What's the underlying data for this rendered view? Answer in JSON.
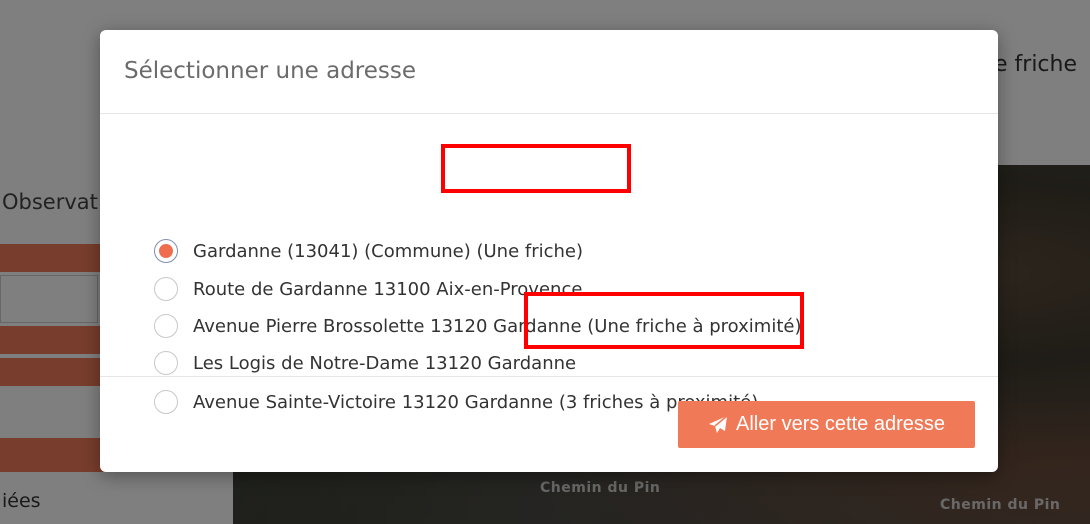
{
  "background": {
    "header_text": "e friche",
    "sidebar_title": "Observat",
    "sidebar_bottom_text": "iées",
    "map_labels": [
      "Chemin du Pin",
      "Chemin du Pin"
    ]
  },
  "modal": {
    "title": "Sélectionner une adresse",
    "selected_index": 0,
    "options": [
      {
        "label": "Gardanne (13041) (Commune) (Une friche)"
      },
      {
        "label": "Route de Gardanne 13100 Aix-en-Provence"
      },
      {
        "label": "Avenue Pierre Brossolette 13120 Gardanne (Une friche à proximité)"
      },
      {
        "label": "Les Logis de Notre-Dame 13120 Gardanne"
      },
      {
        "label": "Avenue Sainte-Victoire 13120 Gardanne (3 friches à proximité)"
      }
    ],
    "go_button": {
      "label": "Aller vers cette adresse",
      "icon": "paper-plane-icon"
    }
  },
  "colors": {
    "accent": "#f07a58",
    "radio_selected": "#ee6e4f",
    "highlight": "#ff0000"
  }
}
